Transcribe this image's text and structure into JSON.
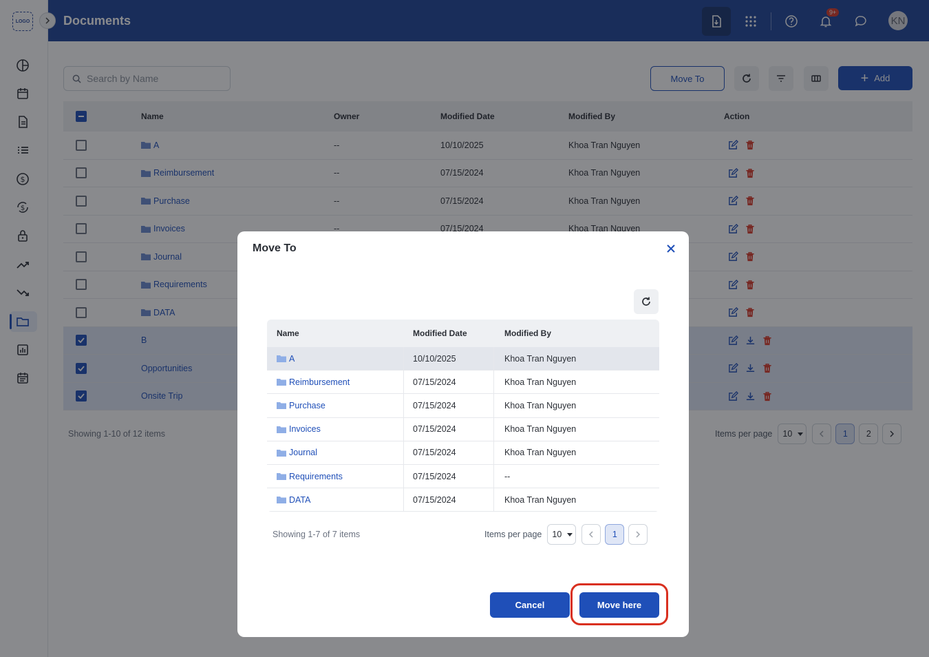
{
  "app": {
    "logo_text": "LOGO",
    "page_title": "Documents",
    "notification_badge": "9+",
    "user_initials": "KN"
  },
  "toolbar": {
    "search_placeholder": "Search by Name",
    "move_to_label": "Move To",
    "add_label": "Add"
  },
  "table": {
    "columns": [
      "Name",
      "Owner",
      "Modified Date",
      "Modified By",
      "Action"
    ],
    "rows": [
      {
        "name": "A",
        "owner": "--",
        "date": "10/10/2025",
        "by": "Khoa Tran Nguyen"
      },
      {
        "name": "Reimbursement",
        "owner": "--",
        "date": "07/15/2024",
        "by": "Khoa Tran Nguyen"
      },
      {
        "name": "Purchase",
        "owner": "--",
        "date": "07/15/2024",
        "by": "Khoa Tran Nguyen"
      },
      {
        "name": "Invoices",
        "owner": "--",
        "date": "07/15/2024",
        "by": "Khoa Tran Nguyen"
      },
      {
        "name": "Journal",
        "owner": "",
        "date": "",
        "by": ""
      },
      {
        "name": "Requirements",
        "owner": "",
        "date": "",
        "by": ""
      },
      {
        "name": "DATA",
        "owner": "",
        "date": "",
        "by": ""
      },
      {
        "name": "B",
        "owner": "",
        "date": "",
        "by": ""
      },
      {
        "name": "Opportunities",
        "owner": "",
        "date": "",
        "by": ""
      },
      {
        "name": "Onsite Trip",
        "owner": "",
        "date": "",
        "by": ""
      }
    ]
  },
  "pagination": {
    "summary": "Showing 1-10 of 12 items",
    "items_per_page_label": "Items per page",
    "items_per_page": "10",
    "pages": [
      "1",
      "2"
    ]
  },
  "modal": {
    "title": "Move To",
    "columns": [
      "Name",
      "Modified Date",
      "Modified By"
    ],
    "rows": [
      {
        "name": "A",
        "date": "10/10/2025",
        "by": "Khoa Tran Nguyen"
      },
      {
        "name": "Reimbursement",
        "date": "07/15/2024",
        "by": "Khoa Tran Nguyen"
      },
      {
        "name": "Purchase",
        "date": "07/15/2024",
        "by": "Khoa Tran Nguyen"
      },
      {
        "name": "Invoices",
        "date": "07/15/2024",
        "by": "Khoa Tran Nguyen"
      },
      {
        "name": "Journal",
        "date": "07/15/2024",
        "by": "Khoa Tran Nguyen"
      },
      {
        "name": "Requirements",
        "date": "07/15/2024",
        "by": "--"
      },
      {
        "name": "DATA",
        "date": "07/15/2024",
        "by": "Khoa Tran Nguyen"
      }
    ],
    "summary": "Showing 1-7 of 7 items",
    "items_per_page_label": "Items per page",
    "items_per_page": "10",
    "page": "1",
    "cancel_label": "Cancel",
    "confirm_label": "Move here"
  },
  "colors": {
    "primary": "#1f4fb8",
    "header": "#1f4599",
    "danger": "#d93a2b",
    "highlight": "#d9301f"
  }
}
